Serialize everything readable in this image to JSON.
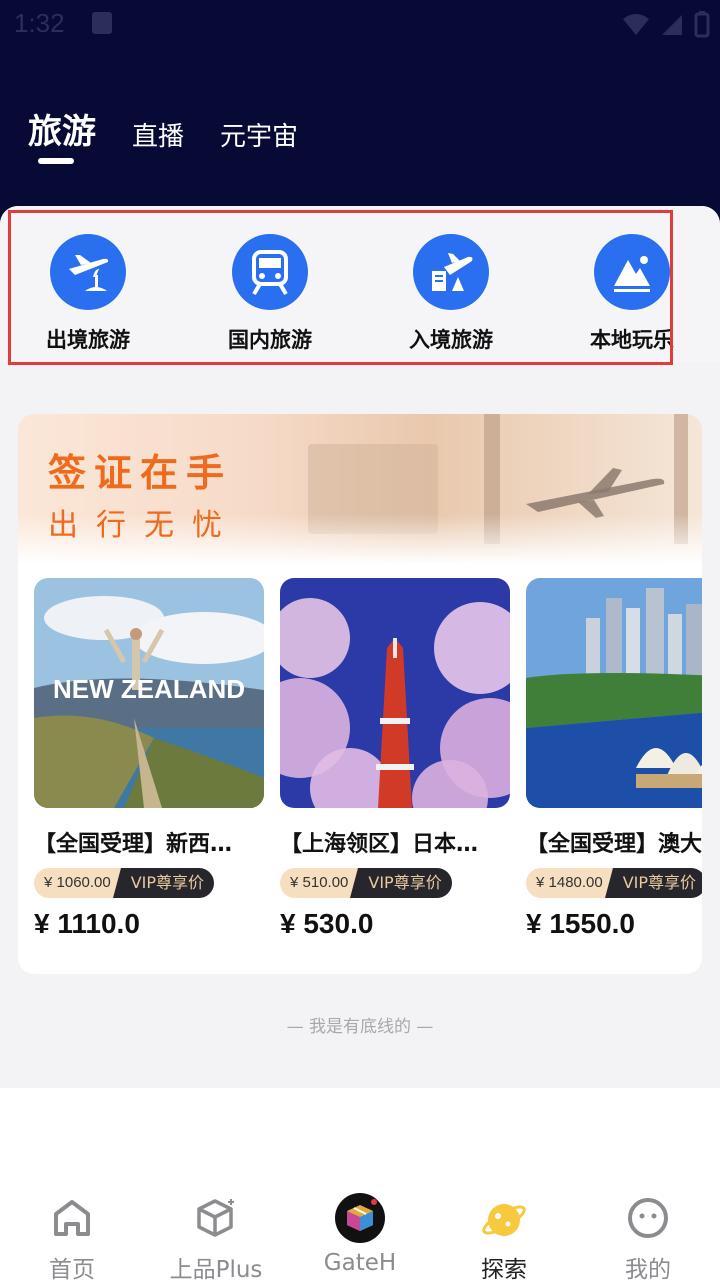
{
  "status_bar": {
    "time": "1:32"
  },
  "top_tabs": [
    {
      "label": "旅游",
      "active": true
    },
    {
      "label": "直播",
      "active": false
    },
    {
      "label": "元宇宙",
      "active": false
    }
  ],
  "categories": [
    {
      "label": "出境旅游",
      "icon": "plane-island-icon"
    },
    {
      "label": "国内旅游",
      "icon": "train-icon"
    },
    {
      "label": "入境旅游",
      "icon": "plane-arrival-icon"
    },
    {
      "label": "本地玩乐",
      "icon": "mountain-icon"
    }
  ],
  "banner": {
    "title": "签证在手",
    "subtitle": "出行无忧"
  },
  "products": [
    {
      "title": "【全国受理】新西兰旅游签证",
      "title_display": "【全国受理】新西…",
      "original_price": "¥ 1060.00",
      "vip_label": "VIP尊享价",
      "price": "¥ 1110.0",
      "image_text": "NEW ZEALAND"
    },
    {
      "title": "【上海领区】日本旅游签证",
      "title_display": "【上海领区】日本…",
      "original_price": "¥ 510.00",
      "vip_label": "VIP尊享价",
      "price": "¥ 530.0"
    },
    {
      "title": "【全国受理】澳大利亚旅游签证",
      "title_display": "【全国受理】澳大",
      "original_price": "¥ 1480.00",
      "vip_label": "VIP尊享价",
      "price": "¥ 1550.0"
    }
  ],
  "footer_text": "— 我是有底线的 —",
  "bottom_nav": [
    {
      "label": "首页",
      "icon": "home-icon",
      "active": false
    },
    {
      "label": "上品Plus",
      "icon": "box-icon",
      "active": false
    },
    {
      "label": "GateH",
      "icon": "cube-icon",
      "active": false
    },
    {
      "label": "探索",
      "icon": "planet-icon",
      "active": true
    },
    {
      "label": "我的",
      "icon": "face-icon",
      "active": false
    }
  ],
  "colors": {
    "header_bg": "#080a36",
    "accent_blue": "#2a6ff0",
    "banner_orange": "#ee6a1c",
    "vip_dark": "#27262d"
  }
}
